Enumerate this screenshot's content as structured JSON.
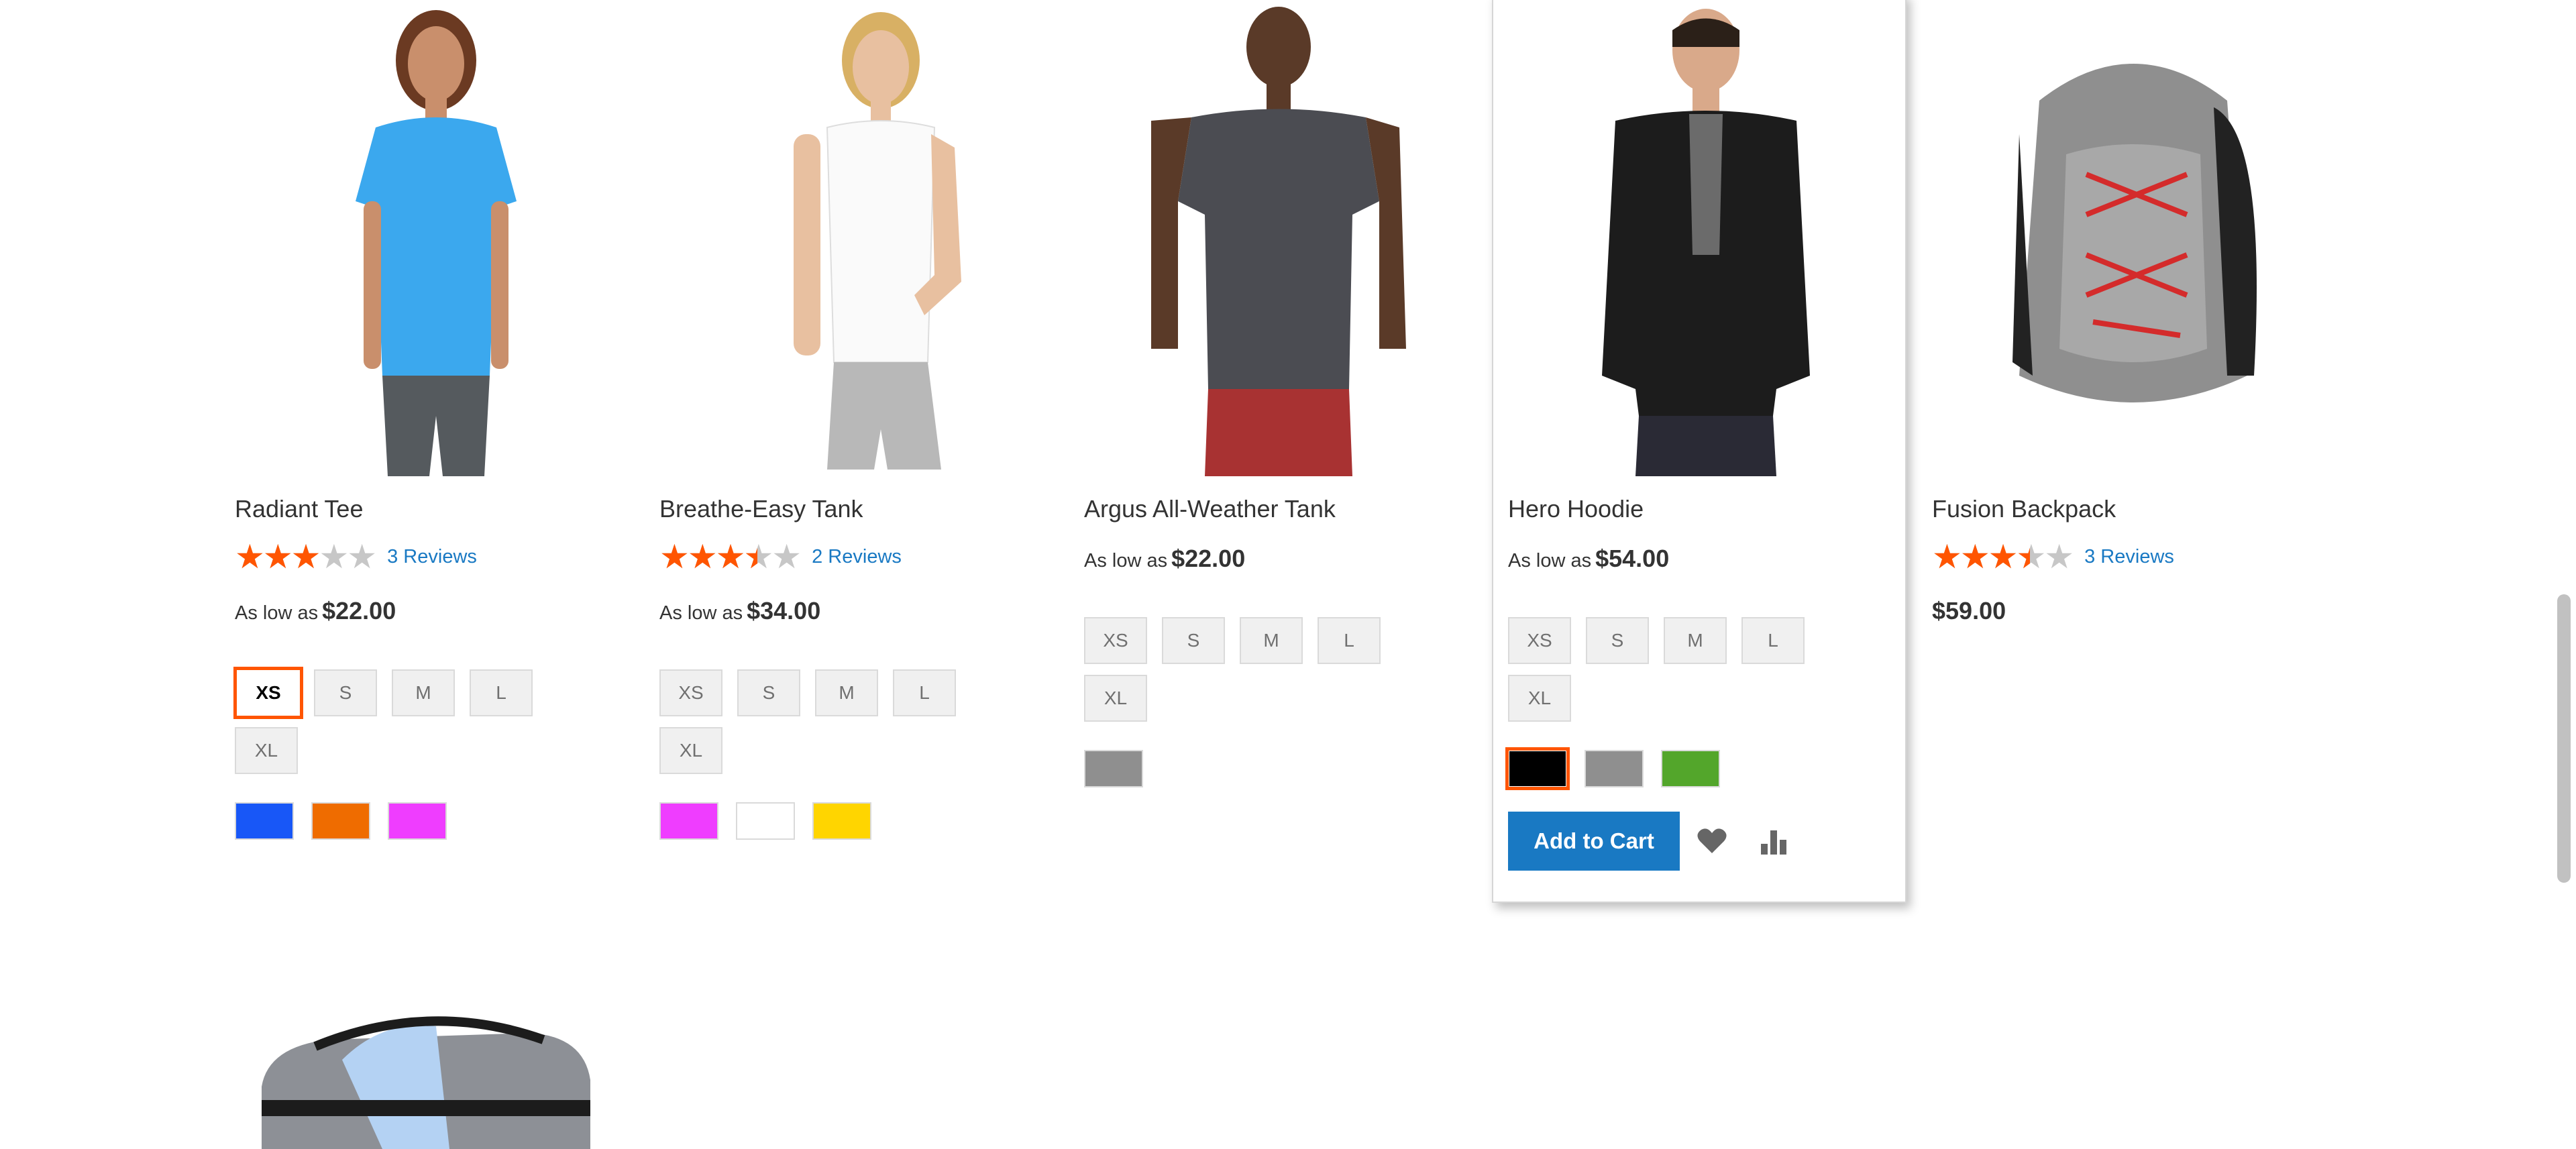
{
  "products": [
    {
      "name": "Radiant Tee",
      "rating_fraction": 0.6,
      "reviews": "3 Reviews",
      "price_prefix": "As low as",
      "price": "$22.00",
      "sizes": [
        "XS",
        "S",
        "M",
        "L",
        "XL"
      ],
      "selected_size": "XS",
      "colors": [
        "#1857f7",
        "#ef6c00",
        "#ef3dff"
      ]
    },
    {
      "name": "Breathe-Easy Tank",
      "rating_fraction": 0.7,
      "reviews": "2 Reviews",
      "price_prefix": "As low as",
      "price": "$34.00",
      "sizes": [
        "XS",
        "S",
        "M",
        "L",
        "XL"
      ],
      "colors": [
        "#ef3dff",
        "#ffffff",
        "#ffd500"
      ]
    },
    {
      "name": "Argus All-Weather Tank",
      "price_prefix": "As low as",
      "price": "$22.00",
      "sizes": [
        "XS",
        "S",
        "M",
        "L",
        "XL"
      ],
      "colors": [
        "#8f8f8f"
      ]
    },
    {
      "name": "Hero Hoodie",
      "price_prefix": "As low as",
      "price": "$54.00",
      "sizes": [
        "XS",
        "S",
        "M",
        "L",
        "XL"
      ],
      "colors": [
        "#000000",
        "#8f8f8f",
        "#53a62b"
      ],
      "selected_color": "#000000",
      "add_to_cart": "Add to Cart",
      "wishlist_icon": "heart-icon",
      "compare_icon": "bar-chart-icon"
    },
    {
      "name": "Fusion Backpack",
      "rating_fraction": 0.7,
      "reviews": "3 Reviews",
      "price": "$59.00"
    }
  ],
  "colors": {
    "star": "#ff5501",
    "link": "#1979c3",
    "button": "#1979c3",
    "selected_border": "#ff5501"
  }
}
